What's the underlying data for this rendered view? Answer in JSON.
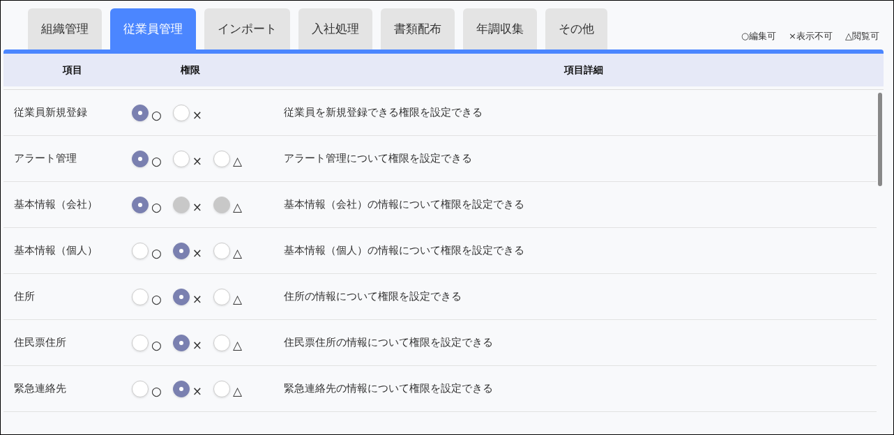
{
  "tabs": [
    {
      "label": "組織管理",
      "selected": false
    },
    {
      "label": "従業員管理",
      "selected": true
    },
    {
      "label": "インポート",
      "selected": false
    },
    {
      "label": "入社処理",
      "selected": false
    },
    {
      "label": "書類配布",
      "selected": false
    },
    {
      "label": "年調収集",
      "selected": false
    },
    {
      "label": "その他",
      "selected": false
    }
  ],
  "legend": [
    "○編集可",
    "×表示不可",
    "△閲覧可"
  ],
  "table": {
    "columns": [
      "項目",
      "権限",
      "項目詳細"
    ],
    "rows": [
      {
        "item": "従業員新規登録",
        "options": [
          {
            "symbol": "○",
            "selected": true,
            "disabled": false
          },
          {
            "symbol": "×",
            "selected": false,
            "disabled": false
          }
        ],
        "detail": "従業員を新規登録できる権限を設定できる"
      },
      {
        "item": "アラート管理",
        "options": [
          {
            "symbol": "○",
            "selected": true,
            "disabled": false
          },
          {
            "symbol": "×",
            "selected": false,
            "disabled": false
          },
          {
            "symbol": "△",
            "selected": false,
            "disabled": false
          }
        ],
        "detail": "アラート管理について権限を設定できる"
      },
      {
        "item": "基本情報（会社）",
        "options": [
          {
            "symbol": "○",
            "selected": true,
            "disabled": false
          },
          {
            "symbol": "×",
            "selected": false,
            "disabled": true
          },
          {
            "symbol": "△",
            "selected": false,
            "disabled": true
          }
        ],
        "detail": "基本情報（会社）の情報について権限を設定できる"
      },
      {
        "item": "基本情報（個人）",
        "options": [
          {
            "symbol": "○",
            "selected": false,
            "disabled": false
          },
          {
            "symbol": "×",
            "selected": true,
            "disabled": false
          },
          {
            "symbol": "△",
            "selected": false,
            "disabled": false
          }
        ],
        "detail": "基本情報（個人）の情報について権限を設定できる"
      },
      {
        "item": "住所",
        "options": [
          {
            "symbol": "○",
            "selected": false,
            "disabled": false
          },
          {
            "symbol": "×",
            "selected": true,
            "disabled": false
          },
          {
            "symbol": "△",
            "selected": false,
            "disabled": false
          }
        ],
        "detail": "住所の情報について権限を設定できる"
      },
      {
        "item": "住民票住所",
        "options": [
          {
            "symbol": "○",
            "selected": false,
            "disabled": false
          },
          {
            "symbol": "×",
            "selected": true,
            "disabled": false
          },
          {
            "symbol": "△",
            "selected": false,
            "disabled": false
          }
        ],
        "detail": "住民票住所の情報について権限を設定できる"
      },
      {
        "item": "緊急連絡先",
        "options": [
          {
            "symbol": "○",
            "selected": false,
            "disabled": false
          },
          {
            "symbol": "×",
            "selected": true,
            "disabled": false
          },
          {
            "symbol": "△",
            "selected": false,
            "disabled": false
          }
        ],
        "detail": "緊急連絡先の情報について権限を設定できる"
      }
    ]
  }
}
